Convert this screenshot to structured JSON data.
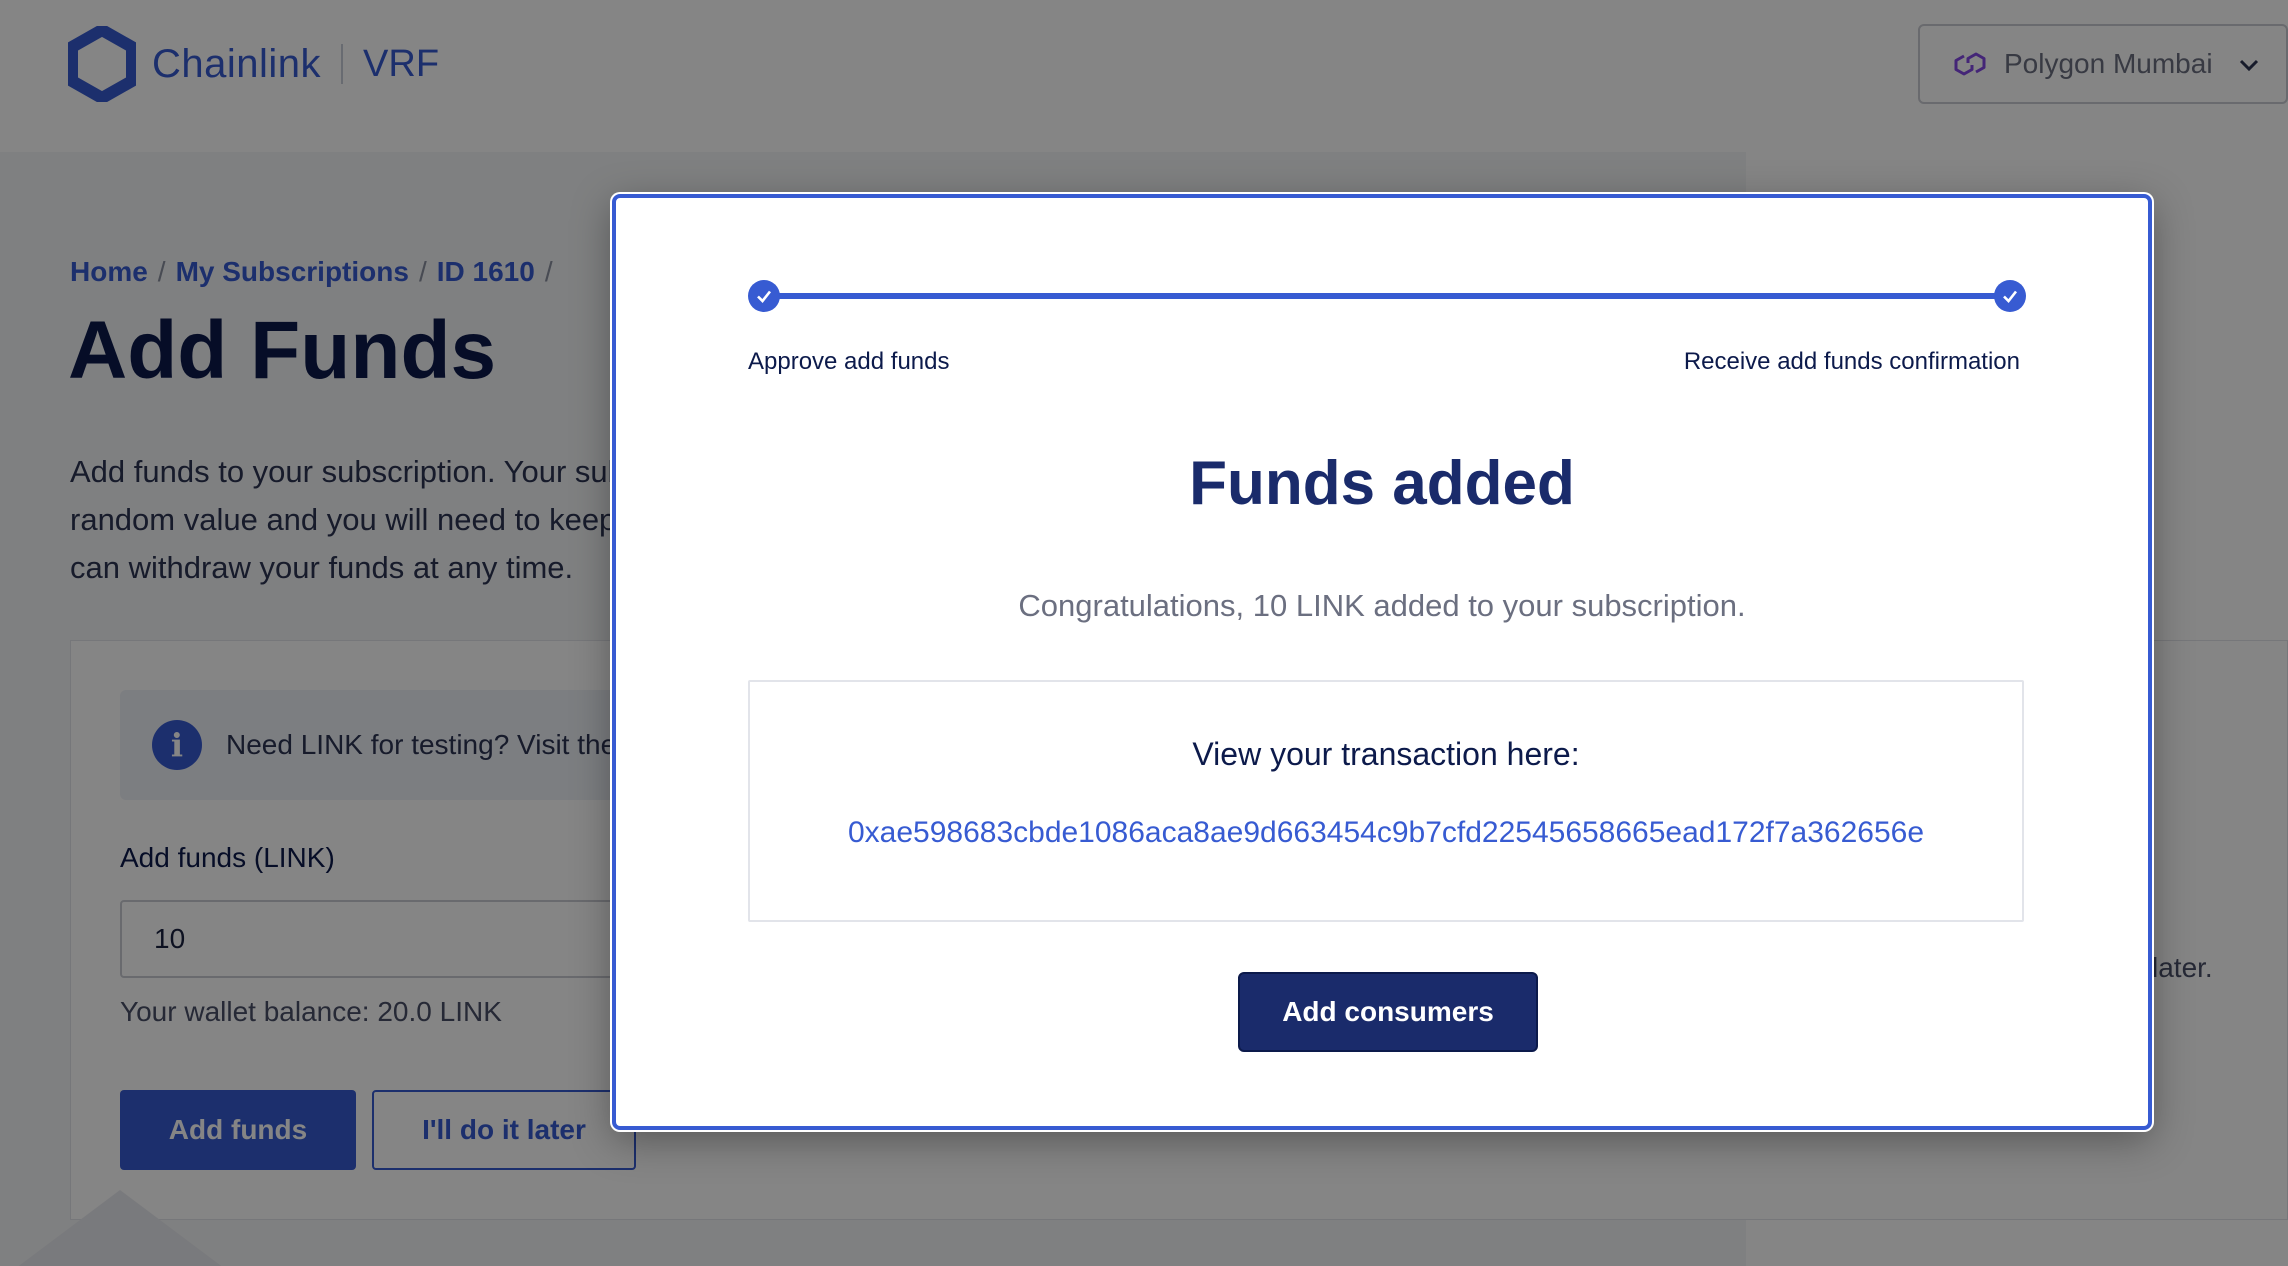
{
  "header": {
    "brand": "Chainlink",
    "product": "VRF",
    "network": {
      "label": "Polygon Mumbai",
      "icon": "polygon-icon"
    }
  },
  "breadcrumb": {
    "home": "Home",
    "subscriptions": "My Subscriptions",
    "id": "ID 1610",
    "sep": "/"
  },
  "page": {
    "title": "Add Funds",
    "description": "Add funds to your subscription. Your subscription is charged each time your contract receives a random value and you will need to keep a minimum LINK balance for the gas lane you specify. You can withdraw your funds at any time.",
    "info_text": "Need LINK for testing? Visit the faucet.",
    "field_label": "Add funds (LINK)",
    "field_value": "10",
    "wallet_balance": "Your wallet balance: 20.0 LINK",
    "add_funds_button": "Add funds",
    "later_button": "I'll do it later",
    "side_text": "later."
  },
  "modal": {
    "steps": [
      "Approve add funds",
      "Receive add funds confirmation"
    ],
    "progress": 1.0,
    "title": "Funds added",
    "subtitle": "Congratulations, 10 LINK added to your subscription.",
    "tx_label": "View your transaction here:",
    "tx_hash": "0xae598683cbde1086aca8ae9d663454c9b7cfd22545658665ead172f7a362656e",
    "cta_button": "Add consumers"
  },
  "colors": {
    "accent": "#375bd2",
    "navy": "#1a2b6b",
    "overlay": "rgba(0,0,0,0.48)"
  }
}
